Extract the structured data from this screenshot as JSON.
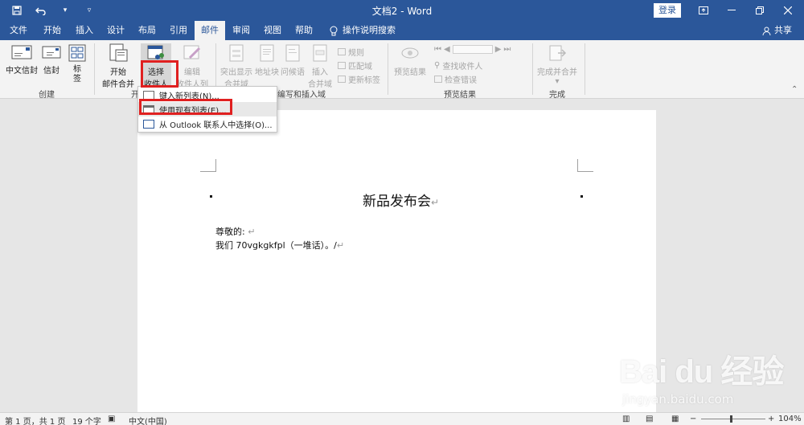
{
  "titlebar": {
    "title": "文档2  -  Word",
    "login_label": "登录"
  },
  "tabs": [
    "文件",
    "开始",
    "插入",
    "设计",
    "布局",
    "引用",
    "邮件",
    "审阅",
    "视图",
    "帮助"
  ],
  "active_tab_index": 6,
  "tell_me": "操作说明搜索",
  "share": "共享",
  "ribbon": {
    "create": {
      "group_label": "创建",
      "btn_envelope_cn": "中文信封",
      "btn_envelope": "信封",
      "btn_label": "标签"
    },
    "start_merge": {
      "group_label": "开",
      "btn_start_merge_l1": "开始",
      "btn_start_merge_l2": "邮件合并",
      "btn_select_recipients_l1": "选择",
      "btn_select_recipients_l2": "收件人",
      "btn_edit_list_l1": "编辑",
      "btn_edit_list_l2": "收件人列表"
    },
    "write_insert": {
      "group_label": "编写和插入域",
      "btn_highlight_l1": "突出显示",
      "btn_highlight_l2": "合并域",
      "btn_address": "地址块",
      "btn_greeting": "问候语",
      "btn_insert_l1": "插入",
      "btn_insert_l2": "合并域",
      "cmd_rules": "规则",
      "cmd_match": "匹配域",
      "cmd_update": "更新标签"
    },
    "preview": {
      "group_label": "预览结果",
      "btn_preview": "预览结果",
      "cmd_find": "查找收件人",
      "cmd_check": "检查错误"
    },
    "finish": {
      "group_label": "完成",
      "btn_finish_l1": "完成并合并"
    }
  },
  "dropdown": {
    "items": [
      "键入新列表(N)...",
      "使用现有列表(E)...",
      "从 Outlook 联系人中选择(O)..."
    ]
  },
  "document": {
    "heading": "新品发布会",
    "line1": "尊敬的:",
    "line2": "我们 70vgkgkfpl（一堆话）。/"
  },
  "watermark": {
    "logo": "Bai du 经验",
    "url": "jingyan.baidu.com"
  },
  "status": {
    "page": "第 1 页，共 1 页",
    "words": "19 个字",
    "lang": "中文(中国)",
    "zoom": "104%"
  },
  "colors": {
    "accent": "#2b579a",
    "highlight": "#e02020"
  }
}
